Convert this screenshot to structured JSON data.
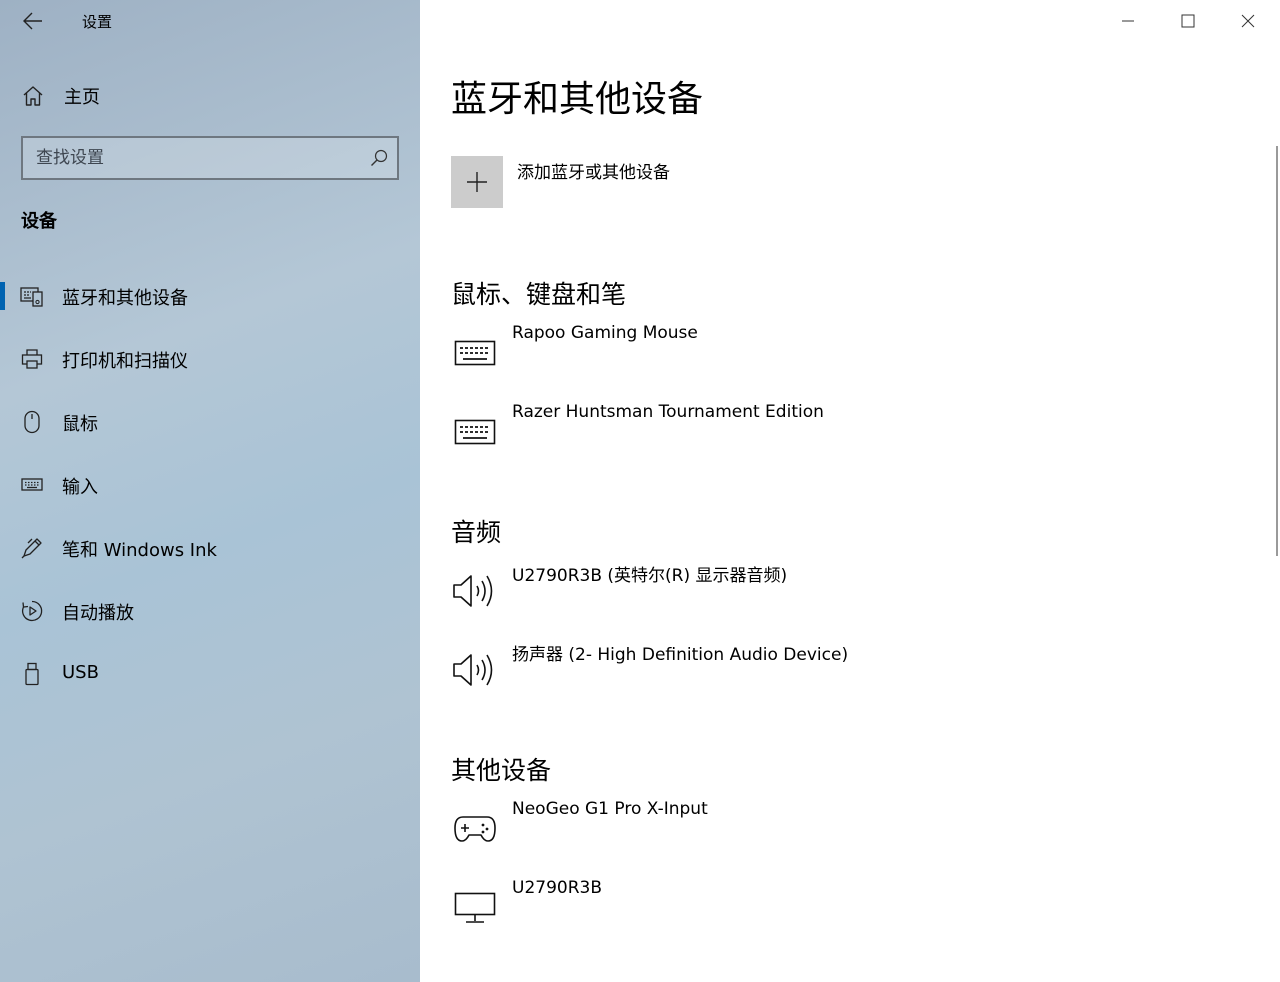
{
  "window": {
    "title": "设置",
    "controls": [
      "minimize-icon",
      "maximize-icon",
      "close-icon"
    ]
  },
  "sidebar": {
    "home_label": "主页",
    "search_placeholder": "查找设置",
    "section_title": "设备",
    "items": [
      {
        "label": "蓝牙和其他设备",
        "icon": "bluetooth-devices-icon",
        "selected": true
      },
      {
        "label": "打印机和扫描仪",
        "icon": "printer-icon",
        "selected": false
      },
      {
        "label": "鼠标",
        "icon": "mouse-icon",
        "selected": false
      },
      {
        "label": "输入",
        "icon": "keyboard-icon",
        "selected": false
      },
      {
        "label": "笔和 Windows Ink",
        "icon": "pen-icon",
        "selected": false
      },
      {
        "label": "自动播放",
        "icon": "autoplay-icon",
        "selected": false
      },
      {
        "label": "USB",
        "icon": "usb-icon",
        "selected": false
      }
    ],
    "accent_color": "#0063b1"
  },
  "main": {
    "title": "蓝牙和其他设备",
    "add_device_label": "添加蓝牙或其他设备",
    "groups": [
      {
        "title": "鼠标、键盘和笔",
        "devices": [
          {
            "name": "Rapoo Gaming Mouse",
            "icon": "keyboard-icon"
          },
          {
            "name": "Razer Huntsman Tournament Edition",
            "icon": "keyboard-icon"
          }
        ]
      },
      {
        "title": "音频",
        "devices": [
          {
            "name": "U2790R3B (英特尔(R) 显示器音频)",
            "icon": "speaker-icon"
          },
          {
            "name": "扬声器 (2- High Definition Audio Device)",
            "icon": "speaker-icon"
          }
        ]
      },
      {
        "title": "其他设备",
        "devices": [
          {
            "name": "NeoGeo G1 Pro X-Input",
            "icon": "gamepad-icon"
          },
          {
            "name": "U2790R3B",
            "icon": "monitor-icon"
          }
        ]
      }
    ]
  }
}
